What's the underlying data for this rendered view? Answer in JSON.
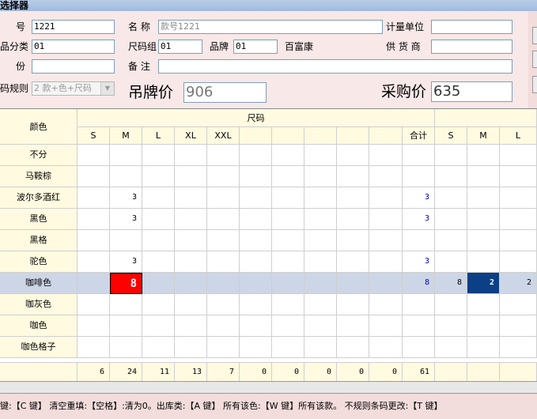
{
  "window": {
    "title": "选择器"
  },
  "form": {
    "code_label": "号",
    "code_value": "1221",
    "name_label": "名  称",
    "name_placeholder": "款号1221",
    "unit_label": "计量单位",
    "unit_value": "",
    "category_label": "品分类",
    "category_value": "01",
    "sizegroup_label": "尺码组",
    "sizegroup_value": "01",
    "brand_label": "品牌",
    "brand_value": "01",
    "brand_name": "百富康",
    "supplier_label": "供 货 商",
    "supplier_value": "",
    "price_label": "份",
    "price_value": "",
    "note_label": "备  注",
    "note_value": "",
    "barcode_label": "码规则",
    "barcode_value": "2 款+色+尺码",
    "tag_price_label": "吊牌价",
    "tag_price_value": "906",
    "purchase_price_label": "采购价",
    "purchase_price_value": "635"
  },
  "grid": {
    "color_header": "颜色",
    "size_header": "尺码",
    "size_columns": [
      "S",
      "M",
      "L",
      "XL",
      "XXL",
      "",
      "",
      "",
      "",
      ""
    ],
    "total_header": "合计",
    "extra_columns": [
      "S",
      "M",
      "L"
    ],
    "rows": [
      {
        "color": "不分",
        "values": [
          "",
          "",
          "",
          "",
          "",
          "",
          "",
          "",
          "",
          ""
        ],
        "total": "",
        "extra": [
          "",
          "",
          ""
        ]
      },
      {
        "color": "马鞍棕",
        "values": [
          "",
          "",
          "",
          "",
          "",
          "",
          "",
          "",
          "",
          ""
        ],
        "total": "",
        "extra": [
          "",
          "",
          ""
        ]
      },
      {
        "color": "波尔多酒红",
        "values": [
          "",
          "3",
          "",
          "",
          "",
          "",
          "",
          "",
          "",
          ""
        ],
        "total": "3",
        "extra": [
          "",
          "",
          ""
        ]
      },
      {
        "color": "黑色",
        "values": [
          "",
          "3",
          "",
          "",
          "",
          "",
          "",
          "",
          "",
          ""
        ],
        "total": "3",
        "extra": [
          "",
          "",
          ""
        ]
      },
      {
        "color": "黑格",
        "values": [
          "",
          "",
          "",
          "",
          "",
          "",
          "",
          "",
          "",
          ""
        ],
        "total": "",
        "extra": [
          "",
          "",
          ""
        ]
      },
      {
        "color": "驼色",
        "values": [
          "",
          "3",
          "",
          "",
          "",
          "",
          "",
          "",
          "",
          ""
        ],
        "total": "3",
        "extra": [
          "",
          "",
          ""
        ]
      },
      {
        "color": "咖啡色",
        "values": [
          "",
          "8",
          "",
          "",
          "",
          "",
          "",
          "",
          "",
          ""
        ],
        "total": "8",
        "extra": [
          "8",
          "2",
          "2"
        ],
        "selected": true
      },
      {
        "color": "咖灰色",
        "values": [
          "",
          "",
          "",
          "",
          "",
          "",
          "",
          "",
          "",
          ""
        ],
        "total": "",
        "extra": [
          "",
          "",
          ""
        ]
      },
      {
        "color": "咖色",
        "values": [
          "",
          "",
          "",
          "",
          "",
          "",
          "",
          "",
          "",
          ""
        ],
        "total": "",
        "extra": [
          "",
          "",
          ""
        ]
      },
      {
        "color": "咖色格子",
        "values": [
          "",
          "",
          "",
          "",
          "",
          "",
          "",
          "",
          "",
          ""
        ],
        "total": "",
        "extra": [
          "",
          "",
          ""
        ]
      }
    ],
    "footer": [
      "6",
      "24",
      "11",
      "13",
      "7",
      "0",
      "0",
      "0",
      "0",
      "0"
    ],
    "footer_total": "61"
  },
  "status": {
    "text": "键:【C 键】 清空重填:【空格】:清为0。出库类:【A 键】 所有该色:【W 键】所有该款。 不规则条码更改:【T 键】"
  }
}
